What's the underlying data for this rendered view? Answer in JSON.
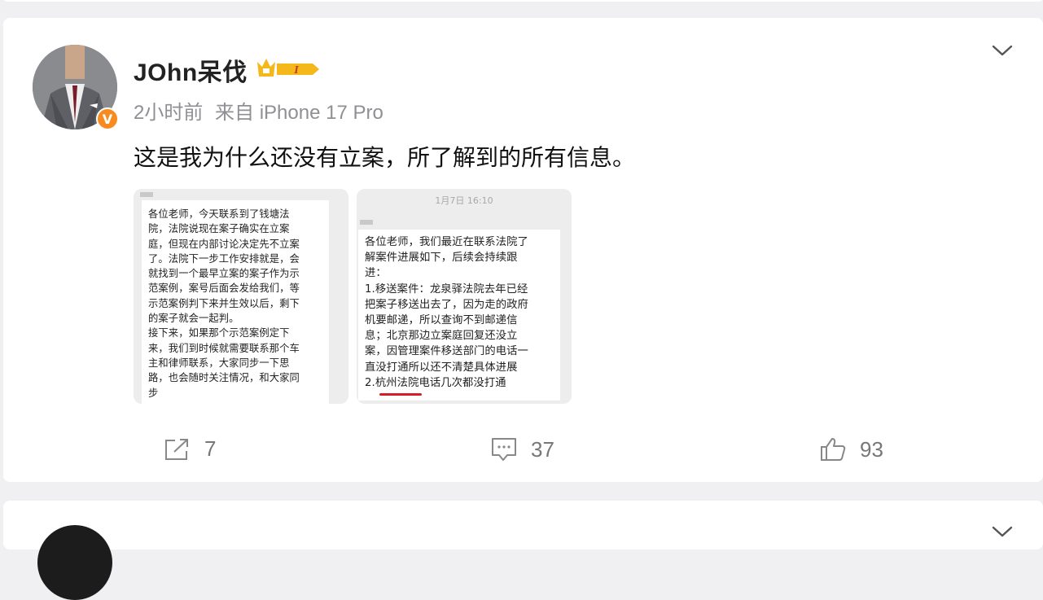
{
  "post": {
    "username": "JOhn呆伐",
    "time": "2小时前",
    "source": "来自 iPhone 17 Pro",
    "text": "这是我为什么还没有立案，所了解到的所有信息。",
    "vip_level": "I",
    "verified_badge": "V",
    "images": [
      {
        "message": "各位老师，今天联系到了钱塘法\n院，法院说现在案子确实在立案\n庭，但现在内部讨论决定先不立案\n了。法院下一步工作安排就是，会\n就找到一个最早立案的案子作为示\n范案例，案号后面会发给我们，等\n示范案例判下来并生效以后，剩下\n的案子就会一起判。\n接下来，如果那个示范案例定下\n来，我们到时候就需要联系那个车\n主和律师联系，大家同步一下思\n路，也会随时关注情况，和大家同\n步"
      },
      {
        "timestamp": "1月7日 16:10",
        "message": "各位老师，我们最近在联系法院了\n解案件进展如下，后续会持续跟\n进：\n1.移送案件：龙泉驿法院去年已经\n把案子移送出去了，因为走的政府\n机要邮递，所以查询不到邮递信\n息；北京那边立案庭回复还没立\n案，因管理案件移送部门的电话一\n直没打通所以还不清楚具体进展\n2.杭州法院电话几次都没打通"
      }
    ],
    "actions": {
      "share_count": "7",
      "comment_count": "37",
      "like_count": "93"
    }
  },
  "colors": {
    "verified_badge": "#f78b1f",
    "vip_gold": "#f5b81a",
    "underline_red": "#d21e24",
    "meta_gray": "#8f8f94"
  },
  "icons": [
    "chevron-down-icon",
    "share-icon",
    "comment-icon",
    "like-icon",
    "crown-icon",
    "verified-icon"
  ]
}
